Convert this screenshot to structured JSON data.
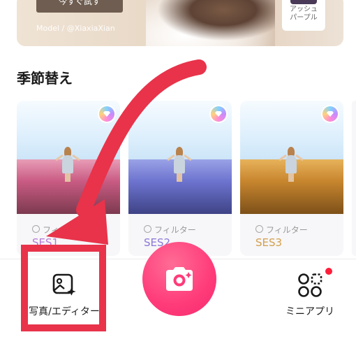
{
  "banner": {
    "try_label": "今すぐ試す",
    "model_credit": "Model / @XiaxiaXian",
    "color_chip_name_line1": "アッシュ",
    "color_chip_name_line2": "パープル"
  },
  "section": {
    "title": "季節替え"
  },
  "cards": [
    {
      "type": "フィルター",
      "name": "SES1",
      "name_color": "#b57ad6"
    },
    {
      "type": "フィルター",
      "name": "SES2",
      "name_color": "#8b78d8"
    },
    {
      "type": "フィルター",
      "name": "SES3",
      "name_color": "#d2a04d"
    }
  ],
  "nav": {
    "editor_label": "写真/エディター",
    "mini_label": "ミニアプリ"
  },
  "colors": {
    "accent": "#ff3b7a",
    "highlight": "#e8334a"
  },
  "icons": [
    "image-edit-icon",
    "camera-icon",
    "apps-grid-icon",
    "premium-gem-icon",
    "filter-circle-icon"
  ]
}
